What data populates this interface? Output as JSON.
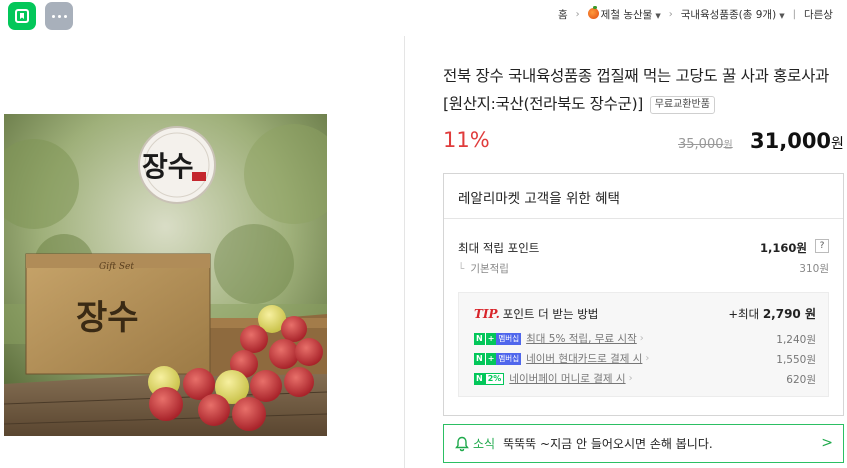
{
  "top_nav": {
    "home": "홈",
    "category": "제철 농산물",
    "subcategory": "국내육성품종(총 9개)",
    "other": "다른상"
  },
  "product": {
    "image_brand_text": "장수",
    "image_box_text": "Gift Set",
    "title": "전북 장수 국내육성품종 껍질째 먹는 고당도 꿀 사과 홍로사과 [원산지:국산(전라북도 장수군)]",
    "free_exchange_badge": "무료교환반품",
    "discount": "11%",
    "original_price": "35,000",
    "original_unit": "원",
    "sale_price": "31,000",
    "sale_unit": "원"
  },
  "benefits": {
    "title": "레알리마켓 고객을 위한 혜택",
    "max_points_label": "최대 적립 포인트",
    "max_points_value": "1,160원",
    "help": "?",
    "basic_label": "기본적립",
    "basic_value": "310원",
    "tip": {
      "tip_word": "TIP.",
      "heading": "포인트 더 받는 방법",
      "total_prefix": "+최대",
      "total_value": "2,790 원",
      "rows": [
        {
          "text": "최대 5% 적립, 무료 시작",
          "amount": "1,240원"
        },
        {
          "text": "네이버 현대카드로 결제 시",
          "amount": "1,550원"
        },
        {
          "text": "네이버페이 머니로 결제 시",
          "amount": "620원"
        }
      ],
      "badges": {
        "n": "N",
        "plus": "+",
        "membership": "멤버십",
        "pay_pct": "2%"
      }
    }
  },
  "news": {
    "label": "소식",
    "text": "뚝뚝뚝 ~지금 안 들어오시면 손해 봅니다."
  },
  "colors": {
    "naver_green": "#03c75a",
    "discount_red": "#e03c3c",
    "news_green": "#1ea94b"
  }
}
